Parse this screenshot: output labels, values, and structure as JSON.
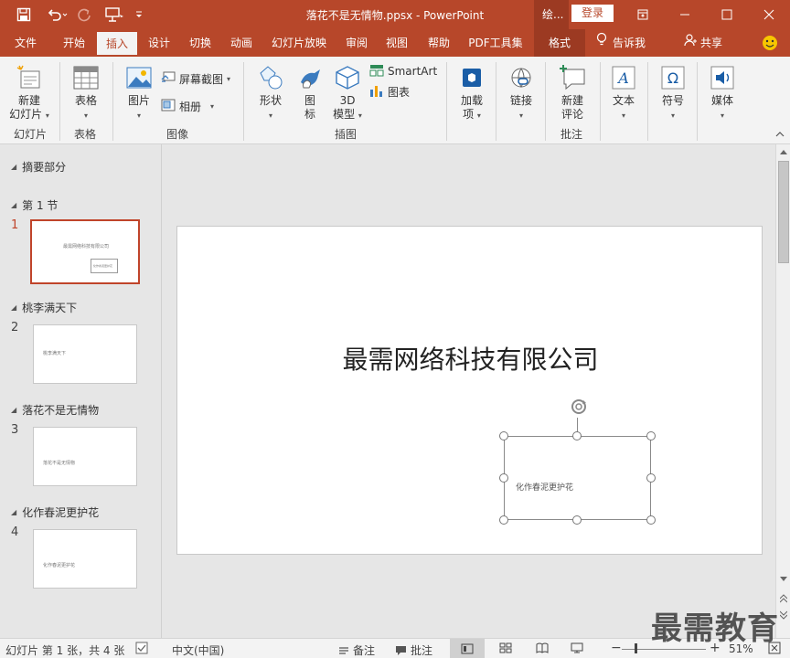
{
  "titlebar": {
    "doc_title": "落花不是无情物.ppsx  -  PowerPoint",
    "context_title": "绘...",
    "login": "登录"
  },
  "menu": {
    "tabs": [
      "文件",
      "开始",
      "插入",
      "设计",
      "切换",
      "动画",
      "幻灯片放映",
      "审阅",
      "视图",
      "帮助",
      "PDF工具集",
      "格式"
    ],
    "active_tab": "插入",
    "tell_me": "告诉我",
    "share": "共享"
  },
  "ribbon": {
    "new_slide": "新建\n幻灯片",
    "table": "表格",
    "picture": "图片",
    "screenshot": "屏幕截图",
    "album": "相册",
    "shapes": "形状",
    "icons": "图\n标",
    "model3d": "3D\n模型",
    "smartart": "SmartArt",
    "chart": "图表",
    "addins": "加载\n项",
    "link": "链接",
    "new_comment": "新建\n评论",
    "text": "文本",
    "symbol": "符号",
    "media": "媒体",
    "groups": {
      "slides": "幻灯片",
      "tables": "表格",
      "images": "图像",
      "illustrations": "插图",
      "comments": "批注"
    }
  },
  "sections": [
    {
      "title": "摘要部分"
    },
    {
      "title": "第 1 节",
      "slide_num": "1",
      "thumb_title": "最需网络科技有限公司",
      "thumb_sub": "化作春泥更护花"
    },
    {
      "title": "桃李满天下",
      "slide_num": "2",
      "thumb_text": "桃李满天下"
    },
    {
      "title": "落花不是无情物",
      "slide_num": "3",
      "thumb_text": "落花不是无情物"
    },
    {
      "title": "化作春泥更护花",
      "slide_num": "4",
      "thumb_text": "化作春泥更护花"
    }
  ],
  "slide": {
    "title": "最需网络科技有限公司",
    "subtitle": "化作春泥更护花"
  },
  "status": {
    "slide_info": "幻灯片 第 1 张，共 4 张",
    "language": "中文(中国)",
    "notes": "备注",
    "comments": "批注",
    "zoom": "51%"
  },
  "watermark": "最需教育",
  "colors": {
    "accent": "#b7472a"
  }
}
